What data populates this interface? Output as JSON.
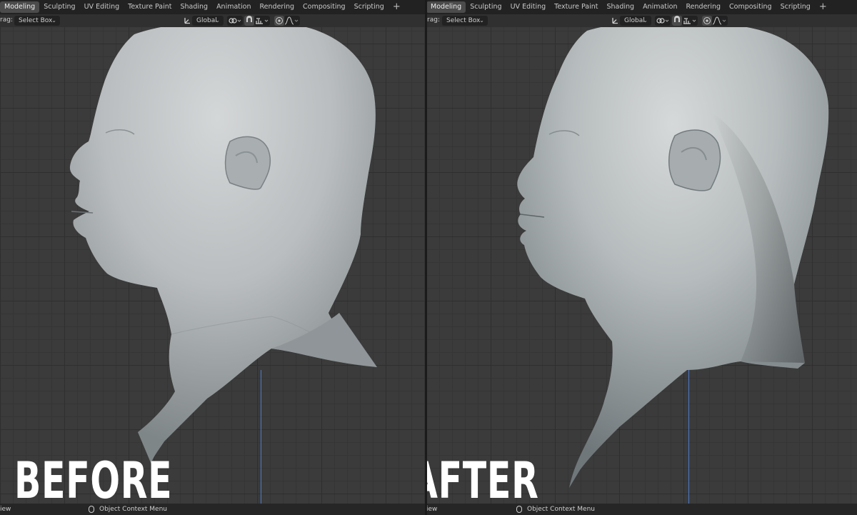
{
  "tabs": [
    "Modeling",
    "Sculpting",
    "UV Editing",
    "Texture Paint",
    "Shading",
    "Animation",
    "Rendering",
    "Compositing",
    "Scripting"
  ],
  "add_tab_label": "+",
  "header": {
    "drag_label": "rag:",
    "select_mode": "Select Box",
    "orientation": "Global"
  },
  "status": {
    "view_label": "iew",
    "context_menu": "Object Context Menu"
  },
  "labels": {
    "before": "BEFORE",
    "after": "AFTER"
  },
  "icons": [
    "orientation-icon",
    "snap-link-icon",
    "snap-magnet-icon",
    "snap-increment-icon",
    "proportional-edit-icon",
    "falloff-curve-icon",
    "mouse-icon"
  ],
  "colors": {
    "ui_dark": "#222222",
    "viewport": "#3b3b3b",
    "grid": "#2f2f2f",
    "axis_blue": "#4d79c7",
    "mesh_light": "#c6cacb",
    "mesh_shadow": "#5f6668"
  }
}
